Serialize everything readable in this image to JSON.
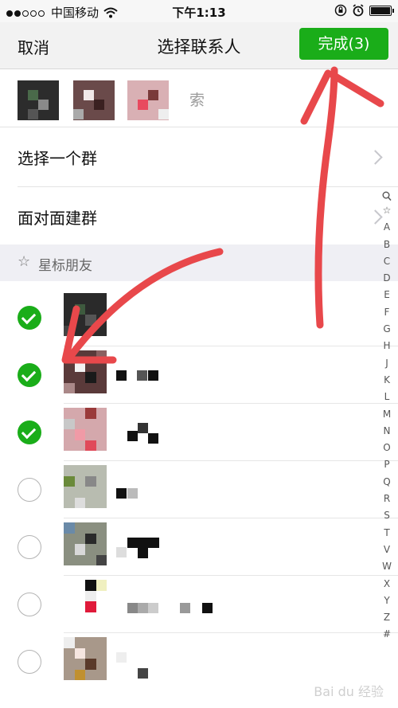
{
  "status_bar": {
    "carrier": "中国移动",
    "time": "下午1:13",
    "signal_dots": [
      1,
      1,
      0,
      0,
      0
    ]
  },
  "nav": {
    "cancel_label": "取消",
    "title": "选择联系人",
    "done_label": "完成(3)"
  },
  "search_hint": "索",
  "menu": [
    {
      "label": "选择一个群"
    },
    {
      "label": "面对面建群"
    }
  ],
  "section": {
    "title": "星标朋友"
  },
  "contacts": [
    {
      "checked": true
    },
    {
      "checked": true
    },
    {
      "checked": true
    },
    {
      "checked": false
    },
    {
      "checked": false
    },
    {
      "checked": false
    },
    {
      "checked": false
    }
  ],
  "index_letters": [
    "☆",
    "A",
    "B",
    "C",
    "D",
    "E",
    "F",
    "G",
    "H",
    "J",
    "K",
    "L",
    "M",
    "N",
    "O",
    "P",
    "Q",
    "R",
    "S",
    "T",
    "V",
    "W",
    "X",
    "Y",
    "Z",
    "#"
  ],
  "colors": {
    "accent": "#1aad19",
    "annotation": "#e8484b"
  }
}
